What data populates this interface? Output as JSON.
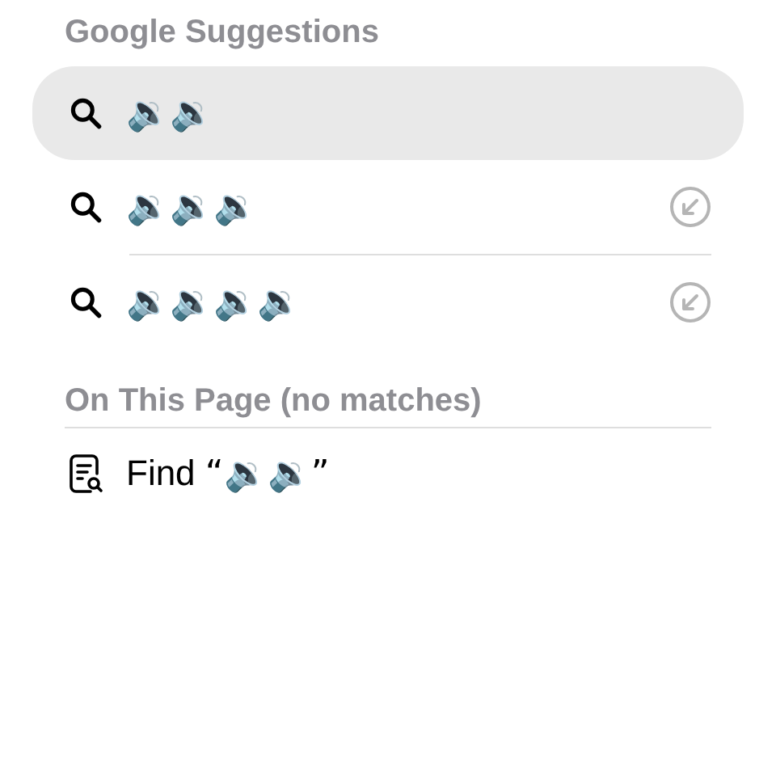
{
  "google_suggestions": {
    "title": "Google Suggestions",
    "items": [
      {
        "text": "🔉🔉",
        "selected": true,
        "fill_arrow": false
      },
      {
        "text": "🔉🔉🔉",
        "selected": false,
        "fill_arrow": true
      },
      {
        "text": "🔉🔉🔉🔉",
        "selected": false,
        "fill_arrow": true
      }
    ]
  },
  "on_this_page": {
    "title": "On This Page (no matches)",
    "find": {
      "label": "Find",
      "query": "“🔉🔉”"
    }
  }
}
